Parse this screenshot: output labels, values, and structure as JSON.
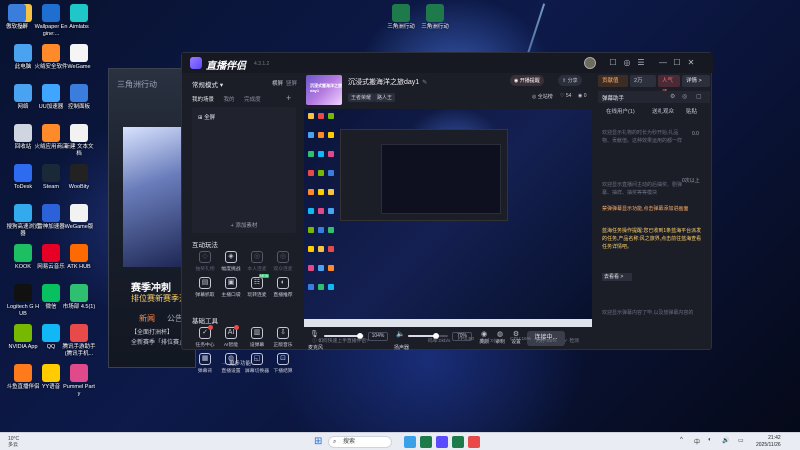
{
  "desktop": {
    "icons": [
      {
        "label": "pc",
        "color": "#f5c242"
      },
      {
        "label": "此电脑",
        "color": "#4aa3f0"
      },
      {
        "label": "网络",
        "color": "#4aa3f0"
      },
      {
        "label": "回收站",
        "color": "#cfd6e0"
      },
      {
        "label": "ToDesk",
        "color": "#2d6cf0"
      },
      {
        "label": "搜狗高速浏览器",
        "color": "#33aaee"
      },
      {
        "label": "KOOK",
        "color": "#1dbf63"
      },
      {
        "label": "Logitech G HUB",
        "color": "#111111"
      },
      {
        "label": "NVIDIA App",
        "color": "#76b900"
      },
      {
        "label": "斗鱼直播伴侣",
        "color": "#ff7a1a"
      },
      {
        "label": "Wallpaper Engine:...",
        "color": "#1f6fd1"
      },
      {
        "label": "火绒安全软件",
        "color": "#ff8a2a"
      },
      {
        "label": "UU加速器",
        "color": "#3fa5ff"
      },
      {
        "label": "火绒应用商店",
        "color": "#ff8a2a"
      },
      {
        "label": "Steam",
        "color": "#1b2838"
      },
      {
        "label": "雷神加速器",
        "color": "#2b62d9"
      },
      {
        "label": "网易云音乐",
        "color": "#e60026"
      },
      {
        "label": "微信",
        "color": "#07c160"
      },
      {
        "label": "QQ",
        "color": "#12b7f5"
      },
      {
        "label": "YY语音",
        "color": "#ffcc00"
      },
      {
        "label": "Aimlabs",
        "color": "#1ec8c8"
      },
      {
        "label": "WeGame",
        "color": "#f5f5f5"
      },
      {
        "label": "控制面板",
        "color": "#3b7ddd"
      },
      {
        "label": "新建 文本文档",
        "color": "#f2f2f2"
      },
      {
        "label": "WooBity",
        "color": "#222222"
      },
      {
        "label": "WeGame版",
        "color": "#f2f2f2"
      },
      {
        "label": "ATK HUB",
        "color": "#ff6a00"
      },
      {
        "label": "市场部 4.5(1)",
        "color": "#2fbf71"
      },
      {
        "label": "腾讯手游助手(腾讯手机...",
        "color": "#e84a4a"
      },
      {
        "label": "Pummel Party",
        "color": "#e04a8a"
      },
      {
        "label": "傲软投屏",
        "color": "#3b7ddd"
      }
    ],
    "top_icons": [
      {
        "label": "三角洲行动",
        "color": "#1e7a4a"
      },
      {
        "label": "三角洲行动",
        "color": "#1e7a4a"
      }
    ],
    "bg_window": {
      "logo": "三角洲行动",
      "title": "赛季冲刺",
      "subtitle": "排位赛新赛季开启",
      "tab1": "新闻",
      "tab2": "公告",
      "lines": [
        "【全面打洲杯】",
        "全新赛季「排位赛」"
      ]
    }
  },
  "app": {
    "name": "直播伴侣",
    "version": "4.3.1.2",
    "titlebar_buttons": [
      "☐",
      "◎",
      "☰",
      "—",
      "☐",
      "✕"
    ],
    "sidebar": {
      "mode": "常规模式",
      "mode_caret": "▾",
      "header_right": [
        "横屏",
        "竖屏"
      ],
      "scene_tabs": [
        "我的场景",
        "我的",
        "完成度"
      ],
      "scene_add": "+",
      "scene_item": "全屏",
      "add_material": "+ 添加素材",
      "interact_title": "互动玩法",
      "interact_tools": [
        {
          "label": "抽奖礼物",
          "icon": "◇",
          "dim": true
        },
        {
          "label": "幅度挑战",
          "icon": "◈",
          "dim": false
        },
        {
          "label": "本人连麦",
          "icon": "◎",
          "dim": true
        },
        {
          "label": "观众连麦",
          "icon": "◎",
          "dim": true
        },
        {
          "label": "弹幕抓取",
          "icon": "▤",
          "dim": false
        },
        {
          "label": "主播口袋",
          "icon": "▣",
          "dim": false
        },
        {
          "label": "玩转连麦",
          "icon": "☷",
          "dim": false,
          "tag": "NEW"
        },
        {
          "label": "直播推荐",
          "icon": "◐",
          "dim": false
        }
      ],
      "basic_title": "基础工具",
      "basic_tools": [
        {
          "label": "任务中心",
          "icon": "✓",
          "badge": true
        },
        {
          "label": "AI智能",
          "icon": "AI",
          "badge": true
        },
        {
          "label": "设弹幕",
          "icon": "▥"
        },
        {
          "label": "正版音乐",
          "icon": "⇩"
        },
        {
          "label": "弹幕背",
          "icon": "▦"
        },
        {
          "label": "直播设置",
          "icon": "◍"
        },
        {
          "label": "屏幕切换器",
          "icon": "◱"
        },
        {
          "label": "下播结算",
          "icon": "⊡"
        }
      ],
      "more": "··· 更多功能"
    },
    "stream": {
      "thumb_text": "沉浸式搬海洋之旅day1",
      "title": "沉浸式搬海洋之旅day1",
      "edit_icon": "✎",
      "tags": [
        "王者荣耀",
        "路人王"
      ],
      "live_notify": "开播提醒",
      "share": "分享",
      "rooms_label": "直播间",
      "rooms": "◎ 全站榜",
      "likes": "54",
      "views": "0"
    },
    "controls": {
      "mic_label": "麦克风",
      "mic_pct": "104%",
      "mic_level": 0.9,
      "speaker_label": "扬声器",
      "speaker_pct": "70%",
      "speaker_level": 0.7,
      "icons": [
        {
          "icon": "◉",
          "label": "美颜"
        },
        {
          "icon": "◍",
          "label": "录制"
        },
        {
          "icon": "⚙",
          "label": "设置"
        }
      ],
      "go_live": "连接中..."
    },
    "statusbar": [
      "ⓘ 如何快速上手直播伴侣?",
      "码率:0kb/s",
      "FPS:60",
      "丢帧:0(0%)",
      "CPU:16%",
      "内存:52%",
      "✓ 检测"
    ],
    "right": {
      "buttons": [
        "贡献值",
        "2万",
        "人气值",
        "详情 >"
      ],
      "panel_title": "弹幕助手",
      "panel_icons": [
        "⚙",
        "◎",
        "▢"
      ],
      "tabs": [
        "在线用户(1)",
        "送礼观众",
        "贴贴"
      ],
      "note1": "欢迎显示礼物的时长为秒开始,礼品物、贡献值。这种效果运用的都一样",
      "counter1": "0.0",
      "counter2": "0次以上",
      "note2": "欢迎显示直播间主动的后抽奖、剧弹幕、抽样、抽奖等等模块",
      "warn": "禁弹弹幕显示功能,点击弹幕添加进画面",
      "yellow": "蓝海任务操作提醒:您已收到1条蓝海平台派发的任务,产品名称:风之旅界,点击前往蓝海查看任务详情吧。",
      "link": "去看看 >",
      "note3": "欢迎显示弹幕内容了毕,以及放弹幕内容的",
      "tail": "欢迎显示新成员了,以及新增用户的弹幕"
    }
  },
  "taskbar": {
    "weather_temp": "10°C",
    "weather_desc": "多云",
    "search": "搜索",
    "apps": [
      {
        "color": "#3aa0e8"
      },
      {
        "color": "#1e7a4a"
      },
      {
        "color": "#5b4bff"
      },
      {
        "color": "#1e7a4a"
      },
      {
        "color": "#e84a4a"
      }
    ],
    "tray": [
      "^",
      "中",
      "◐",
      "🔊",
      "▭"
    ],
    "time": "21:42",
    "date": "2025/11/26"
  }
}
